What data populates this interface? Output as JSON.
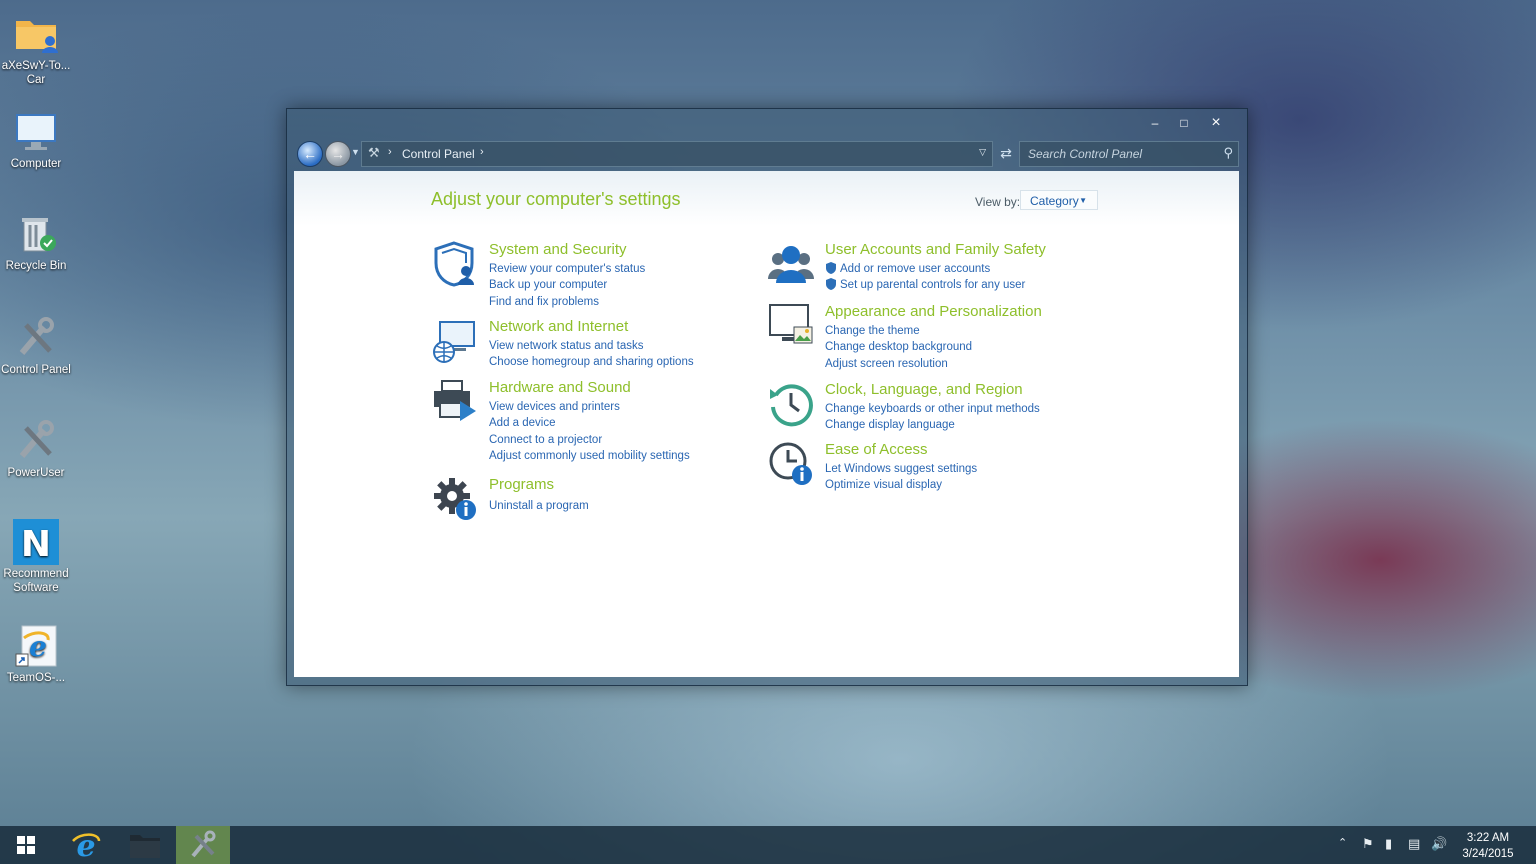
{
  "desktop": {
    "icons": [
      {
        "label": "aXeSwY-To... Car",
        "icon": "folder-user-icon"
      },
      {
        "label": "Computer",
        "icon": "monitor-icon"
      },
      {
        "label": "Recycle Bin",
        "icon": "recycle-bin-icon"
      },
      {
        "label": "Control Panel",
        "icon": "tools-icon"
      },
      {
        "label": "PowerUser",
        "icon": "tools-icon"
      },
      {
        "label": "Recommend Software",
        "icon": "n-app-icon"
      },
      {
        "label": "TeamOS-...",
        "icon": "internet-explorer-shortcut-icon"
      }
    ]
  },
  "window": {
    "controls": {
      "minimize": "–",
      "maximize": "□",
      "close": "×"
    },
    "address": {
      "crumb": "Control Panel"
    },
    "search": {
      "placeholder": "Search Control Panel"
    },
    "title": "Adjust your computer's settings",
    "view_by": {
      "label": "View by:",
      "value": "Category"
    },
    "categories": [
      {
        "title": "System and Security",
        "icon": "shield-user-icon",
        "links": [
          "Review your computer's status",
          "Back up your computer",
          "Find and fix problems"
        ]
      },
      {
        "title": "Network and Internet",
        "icon": "network-globe-icon",
        "links": [
          "View network status and tasks",
          "Choose homegroup and sharing options"
        ]
      },
      {
        "title": "Hardware and Sound",
        "icon": "printer-speaker-icon",
        "links": [
          "View devices and printers",
          "Add a device",
          "Connect to a projector",
          "Adjust commonly used mobility settings"
        ]
      },
      {
        "title": "Programs",
        "icon": "gear-info-icon",
        "links": [
          "Uninstall a program"
        ]
      },
      {
        "title": "User Accounts and Family Safety",
        "icon": "users-icon",
        "links": [
          "Add or remove user accounts",
          "Set up parental controls for any user"
        ]
      },
      {
        "title": "Appearance and Personalization",
        "icon": "monitor-picture-icon",
        "links": [
          "Change the theme",
          "Change desktop background",
          "Adjust screen resolution"
        ]
      },
      {
        "title": "Clock, Language, and Region",
        "icon": "clock-arrow-icon",
        "links": [
          "Change keyboards or other input methods",
          "Change display language"
        ]
      },
      {
        "title": "Ease of Access",
        "icon": "clock-info-icon",
        "links": [
          "Let Windows suggest settings",
          "Optimize visual display"
        ]
      }
    ]
  },
  "taskbar": {
    "clock_time": "3:22 AM",
    "clock_date": "3/24/2015"
  },
  "colors": {
    "accent_green": "#8ebf2b",
    "link_blue": "#2a66b2"
  }
}
